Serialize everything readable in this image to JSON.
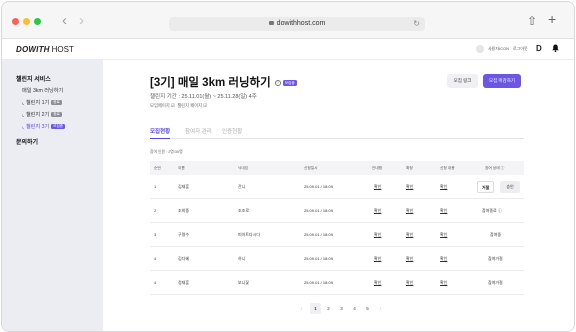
{
  "browser": {
    "url": "dowithhost.com",
    "reload_icon": "↻",
    "share_icon": "⇧",
    "new_tab_icon": "+",
    "back_icon": "‹",
    "forward_icon": "›",
    "traffic_colors": [
      "#fe5f57",
      "#febc2e",
      "#28c840"
    ]
  },
  "header": {
    "logo_bold": "DOWITH",
    "logo_regular": "HOST",
    "user_label": "사용자ICON",
    "logout_label": "로그아웃",
    "d_icon": "D",
    "bell_icon": "♠"
  },
  "sidebar": {
    "section1": "챌린지 서비스",
    "item_challenge": "매일 3km 러닝하기",
    "item_g1": "챌린지 1기",
    "item_g2": "챌린지 2기",
    "item_g3": "챌린지 3기",
    "tag_done": "종료",
    "tag_active": "모집중",
    "section2": "문의하기"
  },
  "main": {
    "title": "[3기] 매일 3km 러닝하기",
    "help_icon": "?",
    "title_badge": "모집중",
    "period": "챌린지 기간 : 25.11.01(월) ~ 25.11.28(일) 4주",
    "link1": "모임페이지 ☑",
    "link2": "챌린지 페이지 ☑",
    "btn_link": "모집 링크",
    "btn_close": "모집 마감하기",
    "tabs": [
      "모집현황",
      "참여자 관리",
      "인증현황"
    ],
    "count": "참여 인원 : 2명/30명"
  },
  "table": {
    "headers": [
      "순번",
      "이름",
      "닉네임",
      "신청일시",
      "안내함",
      "확정",
      "신청 내용",
      "참여 상태 ⓘ"
    ],
    "rows": [
      {
        "no": "1",
        "name": "김재훈",
        "nick": "잔니",
        "date": "25.09.01 / 18:09",
        "notice": "확인",
        "confirm": "확인",
        "content": "확인",
        "status": "",
        "btn1": "거절",
        "btn2": "승인"
      },
      {
        "no": "2",
        "name": "조희중",
        "nick": "조조로",
        "date": "25.09.01 / 18:09",
        "notice": "확인",
        "confirm": "확인",
        "content": "확인",
        "status": "참여종료 ⓘ",
        "btn1": "",
        "btn2": ""
      },
      {
        "no": "3",
        "name": "구명수",
        "nick": "피아트다시다",
        "date": "25.09.01 / 18:09",
        "notice": "확인",
        "confirm": "확인",
        "content": "확인",
        "status": "참여중",
        "btn1": "",
        "btn2": ""
      },
      {
        "no": "4",
        "name": "김다혜",
        "nick": "하니",
        "date": "25.09.01 / 18:09",
        "notice": "확인",
        "confirm": "확인",
        "content": "확인",
        "status": "참여거절",
        "btn1": "",
        "btn2": ""
      },
      {
        "no": "4",
        "name": "정재훈",
        "nick": "보니꽃",
        "date": "25.09.01 / 18:09",
        "notice": "확인",
        "confirm": "확인",
        "content": "확인",
        "status": "참여거절",
        "btn1": "",
        "btn2": ""
      }
    ]
  },
  "pager": {
    "prev": "‹",
    "next": "›",
    "pages": [
      "1",
      "2",
      "3",
      "4",
      "5"
    ],
    "current": "1"
  }
}
